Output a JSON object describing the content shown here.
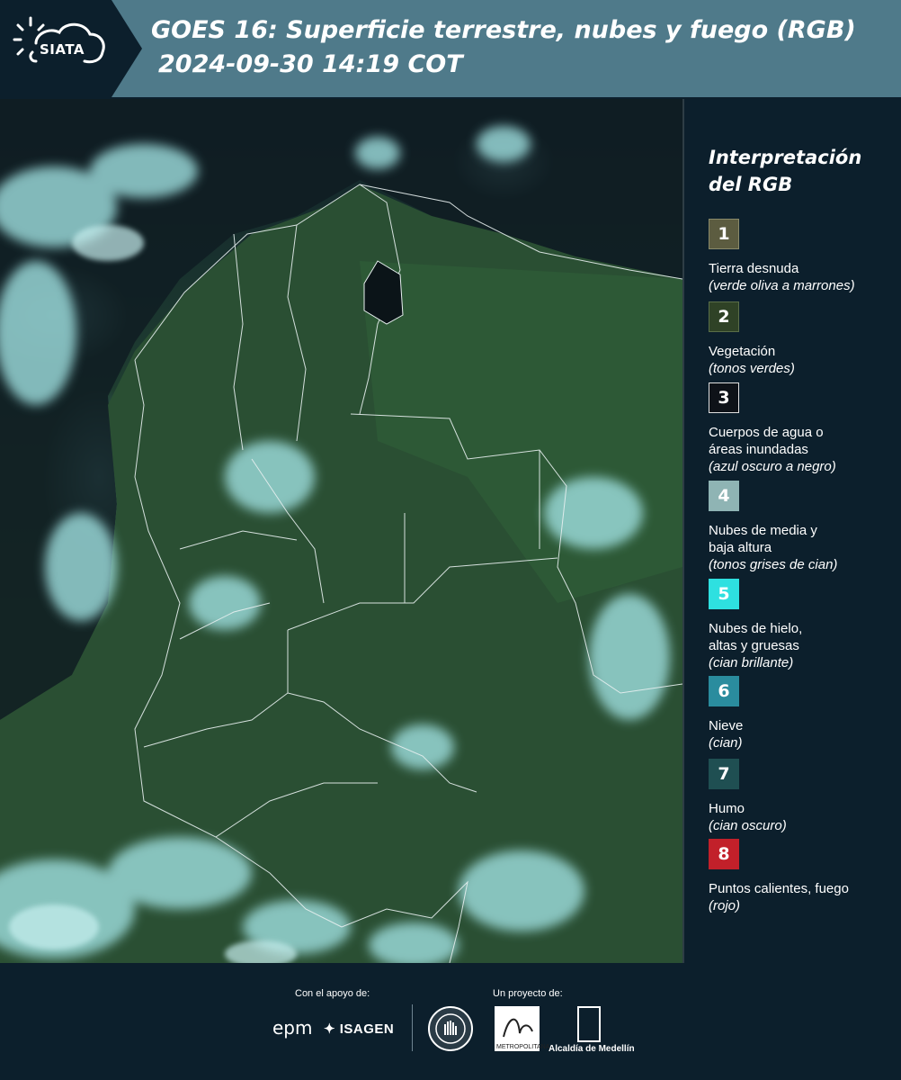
{
  "header": {
    "logo_text": "SIATA",
    "title_line1": "GOES 16: Superficie terrestre, nubes y fuego (RGB)",
    "title_line2": "2024-09-30 14:19 COT",
    "background_color": "#4f7a8a"
  },
  "map": {
    "description_icon": "satellite-image-colombia"
  },
  "legend": {
    "title_line1": "Interpretación",
    "title_line2": "del RGB",
    "items": [
      {
        "number": "1",
        "color": "#5c5c40",
        "name": "Tierra desnuda",
        "desc": "(verde oliva a marrones)"
      },
      {
        "number": "2",
        "color": "#2f4226",
        "name": "Vegetación",
        "desc": "(tonos verdes)"
      },
      {
        "number": "3",
        "color": "#0e1218",
        "name": "Cuerpos de agua o áreas inundadas",
        "desc": "(azul oscuro a negro)"
      },
      {
        "number": "4",
        "color": "#8fb4b4",
        "name": "Nubes de media y baja altura",
        "desc": "(tonos grises de cian)"
      },
      {
        "number": "5",
        "color": "#2ee0e0",
        "name": "Nubes de hielo, altas y gruesas",
        "desc": "(cian brillante)"
      },
      {
        "number": "6",
        "color": "#2a8c9e",
        "name": "Nieve",
        "desc": "(cian)"
      },
      {
        "number": "7",
        "color": "#1f4f52",
        "name": "Humo",
        "desc": "(cian oscuro)"
      },
      {
        "number": "8",
        "color": "#c2202a",
        "name": "Puntos calientes, fuego",
        "desc": "(rojo)"
      }
    ]
  },
  "footer": {
    "support_label": "Con el apoyo de:",
    "project_label": "Un proyecto de:",
    "epm": "epm",
    "isagen": "ISAGEN",
    "area_text": "METROPOLITANA",
    "alcaldia": "Alcaldía de Medellín"
  }
}
